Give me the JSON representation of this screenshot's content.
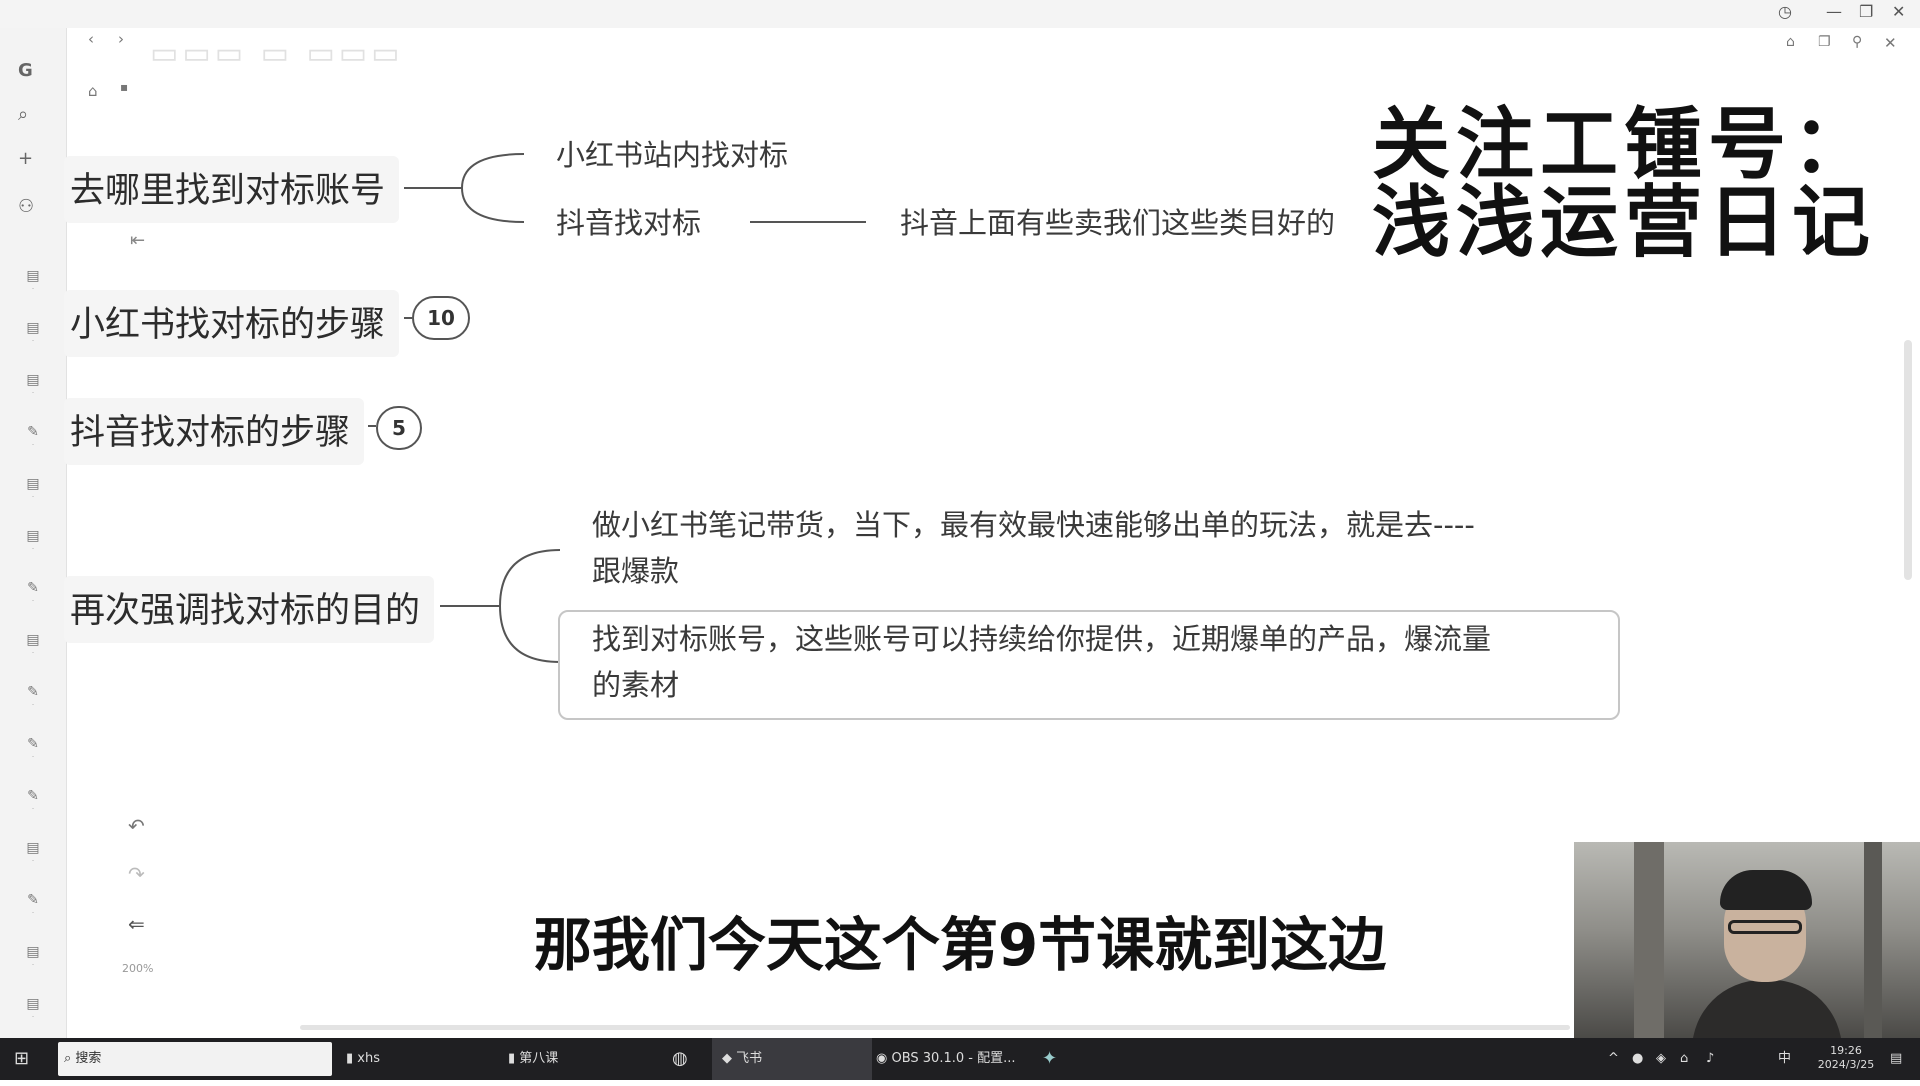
{
  "window": {
    "minimize": "—",
    "maximize": "❐",
    "close": "✕"
  },
  "inner_controls": {
    "restore": "❐",
    "close": "✕"
  },
  "nav": {
    "back": "‹",
    "forward": "›"
  },
  "toolbar": {
    "undo": "↶",
    "redo": "↷",
    "collapse": "⇐",
    "zoom": "200%"
  },
  "mindmap": {
    "branch1": {
      "label": "去哪里找到对标账号",
      "children": [
        "小红书站内找对标",
        "抖音找对标"
      ],
      "detail": "抖音上面有些卖我们这些类目好的"
    },
    "branch2": {
      "label": "小红书找对标的步骤",
      "count": "10"
    },
    "branch3": {
      "label": "抖音找对标的步骤",
      "count": "5"
    },
    "branch4": {
      "label": "再次强调找对标的目的",
      "child1": {
        "line1": "做小红书笔记带货，当下，最有效最快速能够出单的玩法，就是去----",
        "line2": "跟爆款"
      },
      "child2": {
        "line1": "找到对标账号，这些账号可以持续给你提供，近期爆单的产品，爆流量",
        "line2": "的素材"
      }
    }
  },
  "watermark": {
    "line1": "关注工锺号：",
    "line2": "浅浅运营日记"
  },
  "subtitle": "那我们今天这个第9节课就到这边",
  "taskbar": {
    "search_placeholder": "搜索",
    "apps": [
      "xhs",
      "第八课",
      "飞书",
      "OBS 30.1.0 - 配置..."
    ],
    "ime": "中",
    "time": "19:26",
    "date": "2024/3/25"
  },
  "colors": {
    "node_bg": "#f5f5f5",
    "line": "#555555",
    "taskbar": "#1f1f22"
  }
}
